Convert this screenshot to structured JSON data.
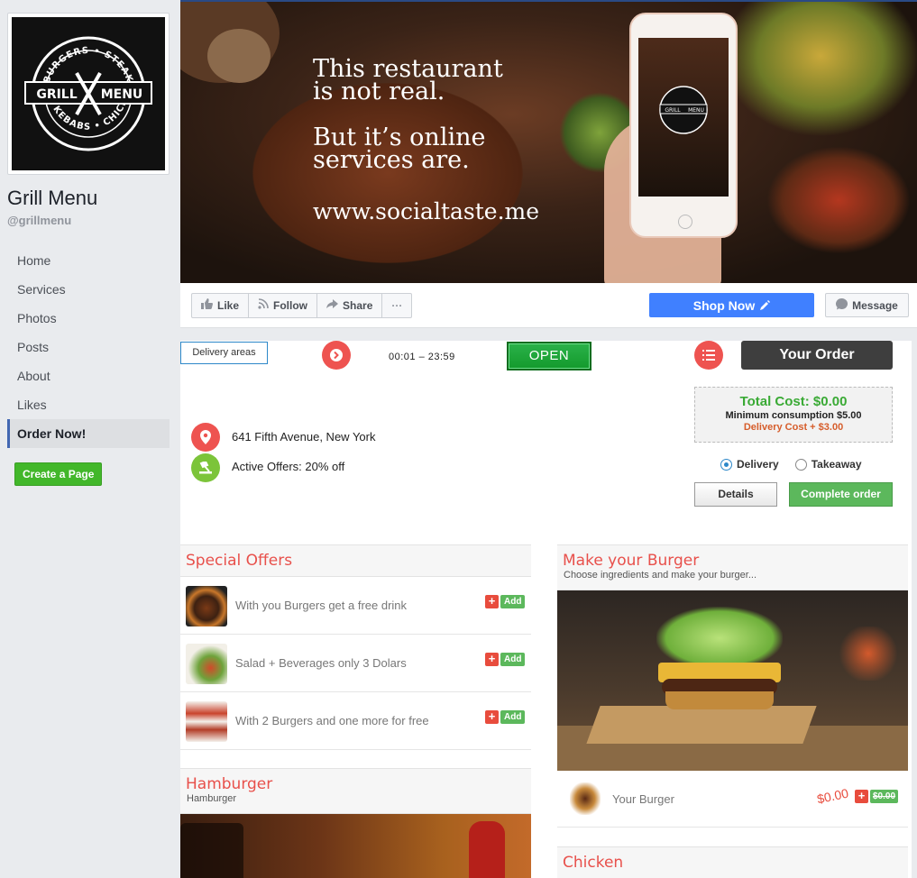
{
  "sidebar": {
    "page_name": "Grill Menu",
    "handle": "@grillmenu",
    "logo_text": [
      "BURGERS",
      "STEAKS",
      "GRILL",
      "MENU",
      "KEBABS",
      "CHICKEN"
    ],
    "nav": [
      {
        "label": "Home"
      },
      {
        "label": "Services"
      },
      {
        "label": "Photos"
      },
      {
        "label": "Posts"
      },
      {
        "label": "About"
      },
      {
        "label": "Likes"
      },
      {
        "label": "Order Now!"
      }
    ],
    "create_page": "Create a Page"
  },
  "cover": {
    "line1": "This restaurant",
    "line2": "is not real.",
    "line3": "But it’s online",
    "line4": "services are.",
    "url": "www.socialtaste.me"
  },
  "action_bar": {
    "like": "Like",
    "follow": "Follow",
    "share": "Share",
    "more": "···",
    "shop_now": "Shop Now",
    "message": "Message"
  },
  "order_panel": {
    "delivery_areas": "Delivery areas",
    "hours": "00:01 – 23:59",
    "status": "OPEN",
    "your_order": "Your Order",
    "total_cost": "Total Cost: $0.00",
    "minimum": "Minimum consumption $5.00",
    "delivery_cost": "Delivery Cost + $3.00",
    "option_delivery": "Delivery",
    "option_takeaway": "Takeaway",
    "selected_option": "Delivery",
    "details": "Details",
    "complete": "Complete order",
    "address": "641 Fifth Avenue, New York",
    "offers": "Active Offers: 20% off"
  },
  "special_offers": {
    "title": "Special Offers",
    "items": [
      {
        "text": "With you Burgers get a free drink",
        "add": "Add"
      },
      {
        "text": "Salad + Beverages only 3 Dolars",
        "add": "Add"
      },
      {
        "text": "With 2 Burgers and one more for free",
        "add": "Add"
      }
    ]
  },
  "make_burger": {
    "title": "Make your Burger",
    "subtitle": "Choose ingredients and make your burger...",
    "item": "Your Burger",
    "price": "$0.00",
    "old_price": "$0.00"
  },
  "hamburger": {
    "title": "Hamburger",
    "subtitle": "Hamburger"
  },
  "chicken": {
    "title": "Chicken"
  },
  "colors": {
    "fb_blue": "#4267b2",
    "shop_blue": "#4080ff",
    "accent_red": "#e8504b",
    "green": "#5cb85c"
  }
}
